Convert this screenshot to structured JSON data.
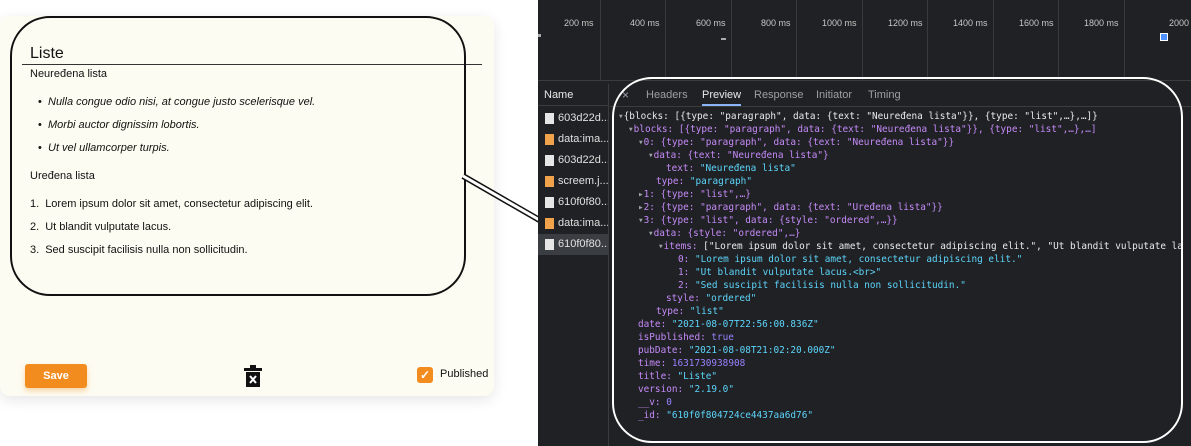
{
  "editor": {
    "title": "Liste",
    "paragraph1": "Neuređena lista",
    "bullets": [
      "Nulla congue odio nisi, at congue justo scelerisque vel.",
      "Morbi auctor dignissim lobortis.",
      "Ut vel ullamcorper turpis."
    ],
    "paragraph2": "Uređena lista",
    "ordered": [
      {
        "num": "1.",
        "text": "Lorem ipsum dolor sit amet, consectetur adipiscing elit."
      },
      {
        "num": "2.",
        "text": "Ut blandit vulputate lacus."
      },
      {
        "num": "3.",
        "text": "Sed suscipit facilisis nulla non sollicitudin."
      }
    ],
    "save_label": "Save",
    "trash_icon": "trash-icon",
    "published_label": "Published",
    "published_checked": true,
    "accent_color": "#f28c1e"
  },
  "devtools": {
    "timeline_ticks": [
      "200 ms",
      "400 ms",
      "600 ms",
      "800 ms",
      "1000 ms",
      "1200 ms",
      "1400 ms",
      "1600 ms",
      "1800 ms",
      "2000"
    ],
    "names_header": "Name",
    "requests": [
      {
        "name": "603d22d...",
        "icon": "file-icon"
      },
      {
        "name": "data:ima...",
        "icon": "image-icon"
      },
      {
        "name": "603d22d...",
        "icon": "file-icon"
      },
      {
        "name": "screem.j...",
        "icon": "image-icon"
      },
      {
        "name": "610f0f80...",
        "icon": "file-icon"
      },
      {
        "name": "data:ima...",
        "icon": "image-icon"
      },
      {
        "name": "610f0f80...",
        "icon": "file-icon"
      }
    ],
    "tab_close": "×",
    "tabs": [
      "Headers",
      "Preview",
      "Response",
      "Initiator",
      "Timing"
    ],
    "active_tab": "Preview",
    "preview": {
      "root": "{blocks: [{type: \"paragraph\", data: {text: \"Neuređena lista\"}}, {type: \"list\",…},…]}",
      "blocks": "blocks: [{type: \"paragraph\", data: {text: \"Neuređena lista\"}}, {type: \"list\",…},…]",
      "b0": "0: {type: \"paragraph\", data: {text: \"Neuređena lista\"}}",
      "b0_data": "data: {text: \"Neuređena lista\"}",
      "b0_text_key": "text: ",
      "b0_text_val": "\"Neuređena lista\"",
      "b0_type_key": "type: ",
      "b0_type_val": "\"paragraph\"",
      "b1": "1: {type: \"list\",…}",
      "b2": "2: {type: \"paragraph\", data: {text: \"Uređena lista\"}}",
      "b3": "3: {type: \"list\", data: {style: \"ordered\",…}}",
      "b3_data": "data: {style: \"ordered\",…}",
      "items_key": "items: ",
      "items_val": "[\"Lorem ipsum dolor sit amet, consectetur adipiscing elit.\", \"Ut blandit vulputate la",
      "item0_key": "0: ",
      "item0_val": "\"Lorem ipsum dolor sit amet, consectetur adipiscing elit.\"",
      "item1_key": "1: ",
      "item1_val": "\"Ut blandit vulputate lacus.<br>\"",
      "item2_key": "2: ",
      "item2_val": "\"Sed suscipit facilisis nulla non sollicitudin.\"",
      "style_key": "style: ",
      "style_val": "\"ordered\"",
      "type_key": "type: ",
      "type_val": "\"list\"",
      "date_key": "date: ",
      "date_val": "\"2021-08-07T22:56:00.836Z\"",
      "isPublished_key": "isPublished: ",
      "isPublished_val": "true",
      "pubDate_key": "pubDate: ",
      "pubDate_val": "\"2021-08-08T21:02:20.000Z\"",
      "time_key": "time: ",
      "time_val": "1631730938908",
      "title_key": "title: ",
      "title_val": "\"Liste\"",
      "version_key": "version: ",
      "version_val": "\"2.19.0\"",
      "v_key": "__v: ",
      "v_val": "0",
      "id_key": "_id: ",
      "id_val": "\"610f0f804724ce4437aa6d76\""
    }
  }
}
